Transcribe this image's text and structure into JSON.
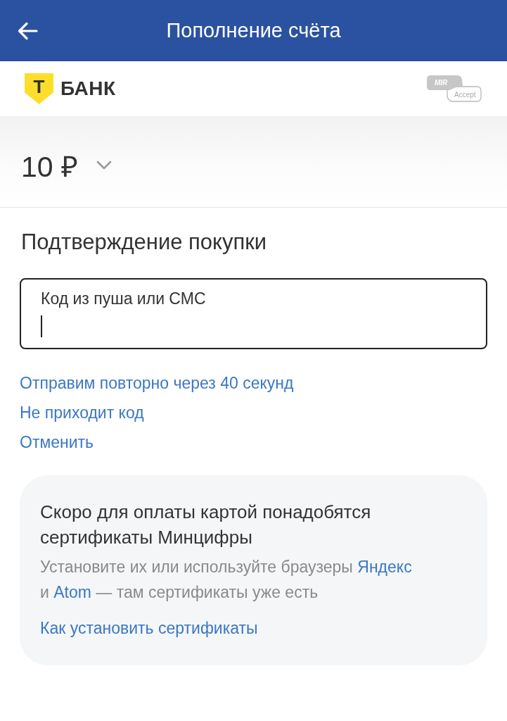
{
  "header": {
    "title": "Пополнение счёта"
  },
  "merchant": {
    "bank_logo": {
      "mark": "Т",
      "name": "БАНК"
    },
    "payment_logo": {
      "top": "MIR",
      "bottom": "Accept"
    }
  },
  "amount": {
    "value": "10 ₽"
  },
  "confirmation": {
    "title": "Подтверждение покупки",
    "code_field": {
      "label": "Код из пуша или СМС",
      "focused": true
    },
    "links": [
      "Отправим повторно через 40 секунд",
      "Не приходит код",
      "Отменить"
    ]
  },
  "info_card": {
    "title": "Скоро для оплаты картой понадобятся сертификаты Минцифры",
    "body": [
      {
        "kind": "text",
        "text": "Установите их или используйте браузеры "
      },
      {
        "kind": "link",
        "text": "Яндекс"
      },
      {
        "kind": "text",
        "text": " и "
      },
      {
        "kind": "link",
        "text": "Atom"
      },
      {
        "kind": "text",
        "text": " — там сертификаты уже есть"
      }
    ],
    "link": "Как установить сертификаты"
  }
}
